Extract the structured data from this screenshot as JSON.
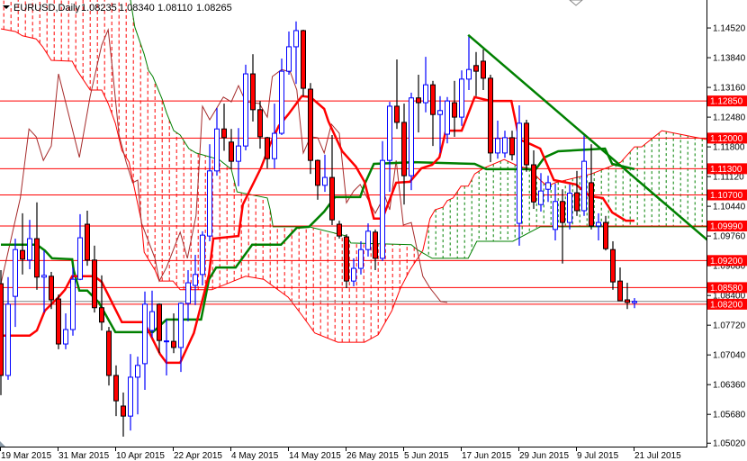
{
  "header": {
    "symbol": "EURUSD,Daily",
    "open": "1.08235",
    "high": "1.08340",
    "low": "1.08110",
    "close": "1.08265"
  },
  "colors": {
    "bull": "#0000ff",
    "bear": "#ff0000",
    "tenkan": "#ff0000",
    "kijun": "#008000",
    "chikou": "#a52a2a",
    "senkou_a": "#ff0000",
    "senkou_b": "#008000",
    "trendline": "#008000",
    "level": "#ff0000",
    "current": "#808080"
  },
  "chart_data": {
    "type": "candlestick",
    "title": "EURUSD,Daily",
    "ylim": [
      1.0492,
      1.1516
    ],
    "price_ticks": [
      "1.14520",
      "1.13840",
      "1.13160",
      "1.12480",
      "1.11800",
      "1.11120",
      "1.10440",
      "1.09760",
      "1.09080",
      "1.08400",
      "1.07720",
      "1.07040",
      "1.06360",
      "1.05680",
      "1.05020"
    ],
    "date_ticks": [
      {
        "label": "19 Mar 2015",
        "index": 0
      },
      {
        "label": "31 Mar 2015",
        "index": 8
      },
      {
        "label": "10 Apr 2015",
        "index": 16
      },
      {
        "label": "22 Apr 2015",
        "index": 24
      },
      {
        "label": "4 May 2015",
        "index": 32
      },
      {
        "label": "14 May 2015",
        "index": 40
      },
      {
        "label": "26 May 2015",
        "index": 48
      },
      {
        "label": "5 Jun 2015",
        "index": 56
      },
      {
        "label": "17 Jun 2015",
        "index": 64
      },
      {
        "label": "29 Jun 2015",
        "index": 72
      },
      {
        "label": "9 Jul 2015",
        "index": 80
      },
      {
        "label": "21 Jul 2015",
        "index": 88
      }
    ],
    "levels": [
      "1.12850",
      "1.12000",
      "1.11300",
      "1.10700",
      "1.09990",
      "1.09200",
      "1.08580",
      "1.08200"
    ],
    "current_price": 1.08265,
    "ohlc": [
      [
        1.0867,
        1.0898,
        1.0612,
        1.0657
      ],
      [
        1.0657,
        1.0882,
        1.0647,
        1.082
      ],
      [
        1.0838,
        1.097,
        1.0768,
        1.0945
      ],
      [
        1.0943,
        1.1028,
        1.0888,
        1.0923
      ],
      [
        1.0921,
        1.1013,
        1.09,
        1.097
      ],
      [
        1.097,
        1.1053,
        1.0853,
        1.0882
      ],
      [
        1.0882,
        1.0943,
        1.0801,
        1.0886
      ],
      [
        1.0884,
        1.0894,
        1.0809,
        1.083
      ],
      [
        1.0832,
        1.0842,
        1.0717,
        1.0729
      ],
      [
        1.0729,
        1.0799,
        1.0717,
        1.0762
      ],
      [
        1.0762,
        1.0904,
        1.0748,
        1.0877
      ],
      [
        1.0877,
        1.1026,
        1.0875,
        1.0972
      ],
      [
        1.1003,
        1.1034,
        1.0908,
        1.0921
      ],
      [
        1.0921,
        1.0954,
        1.0801,
        1.0812
      ],
      [
        1.0812,
        1.0886,
        1.076,
        1.0779
      ],
      [
        1.0758,
        1.0768,
        1.0634,
        1.0657
      ],
      [
        1.0657,
        1.068,
        1.0564,
        1.0599
      ],
      [
        1.0587,
        1.0618,
        1.0517,
        1.0564
      ],
      [
        1.0564,
        1.0706,
        1.0531,
        1.0653
      ],
      [
        1.0653,
        1.07,
        1.0568,
        1.068
      ],
      [
        1.0684,
        1.0849,
        1.0624,
        1.082
      ],
      [
        1.076,
        1.0851,
        1.0744,
        1.0803
      ],
      [
        1.082,
        1.0822,
        1.0708,
        1.0737
      ],
      [
        1.0735,
        1.0785,
        1.0657,
        1.0736
      ],
      [
        1.0735,
        1.0799,
        1.0708,
        1.0721
      ],
      [
        1.0721,
        1.0824,
        1.0665,
        1.0822
      ],
      [
        1.0822,
        1.0898,
        1.0781,
        1.0869
      ],
      [
        1.0863,
        1.0933,
        1.0818,
        1.0888
      ],
      [
        1.0888,
        1.0987,
        1.0863,
        1.0978
      ],
      [
        1.0976,
        1.1186,
        1.0964,
        1.1125
      ],
      [
        1.1125,
        1.1269,
        1.1114,
        1.1221
      ],
      [
        1.1221,
        1.1279,
        1.1171,
        1.1201
      ],
      [
        1.1191,
        1.1221,
        1.1129,
        1.1147
      ],
      [
        1.1147,
        1.1223,
        1.109,
        1.1182
      ],
      [
        1.1182,
        1.1368,
        1.1172,
        1.1347
      ],
      [
        1.1347,
        1.1392,
        1.1238,
        1.1265
      ],
      [
        1.1265,
        1.1285,
        1.1176,
        1.1203
      ],
      [
        1.1201,
        1.1203,
        1.1131,
        1.1153
      ],
      [
        1.1153,
        1.1279,
        1.1131,
        1.1211
      ],
      [
        1.1211,
        1.1382,
        1.1207,
        1.1353
      ],
      [
        1.1353,
        1.1444,
        1.1345,
        1.1409
      ],
      [
        1.1409,
        1.1467,
        1.1324,
        1.1446
      ],
      [
        1.1446,
        1.1448,
        1.1296,
        1.1314
      ],
      [
        1.1312,
        1.1326,
        1.1118,
        1.1149
      ],
      [
        1.1149,
        1.1151,
        1.1059,
        1.1092
      ],
      [
        1.1092,
        1.1162,
        1.1077,
        1.111
      ],
      [
        1.111,
        1.1207,
        1.1001,
        1.1013
      ],
      [
        1.1003,
        1.1011,
        1.097,
        1.0976
      ],
      [
        1.0974,
        1.098,
        1.0857,
        1.0873
      ],
      [
        1.0873,
        1.0925,
        1.0861,
        1.0902
      ],
      [
        1.0902,
        1.0964,
        1.0888,
        1.0945
      ],
      [
        1.0945,
        1.1005,
        1.0929,
        1.0987
      ],
      [
        1.0985,
        1.0991,
        1.0898,
        1.0925
      ],
      [
        1.0925,
        1.1193,
        1.0919,
        1.1149
      ],
      [
        1.1149,
        1.1283,
        1.1077,
        1.1273
      ],
      [
        1.1273,
        1.138,
        1.1221,
        1.1236
      ],
      [
        1.1236,
        1.1279,
        1.1048,
        1.1114
      ],
      [
        1.1114,
        1.1304,
        1.1081,
        1.1292
      ],
      [
        1.1292,
        1.1345,
        1.1213,
        1.1281
      ],
      [
        1.1281,
        1.1386,
        1.1259,
        1.1322
      ],
      [
        1.1322,
        1.1331,
        1.1182,
        1.1254
      ],
      [
        1.1254,
        1.1296,
        1.1166,
        1.1263
      ],
      [
        1.1209,
        1.1294,
        1.1188,
        1.1285
      ],
      [
        1.1281,
        1.1331,
        1.1203,
        1.1248
      ],
      [
        1.1248,
        1.1355,
        1.1228,
        1.1335
      ],
      [
        1.1335,
        1.1436,
        1.131,
        1.1357
      ],
      [
        1.1366,
        1.1397,
        1.1296,
        1.1353
      ],
      [
        1.1376,
        1.1403,
        1.131,
        1.1337
      ],
      [
        1.1337,
        1.1345,
        1.1145,
        1.1166
      ],
      [
        1.1166,
        1.124,
        1.1153,
        1.1199
      ],
      [
        1.1166,
        1.1217,
        1.1155,
        1.1201
      ],
      [
        1.1201,
        1.1217,
        1.1149,
        1.1162
      ],
      [
        1.1005,
        1.1275,
        1.0954,
        1.1234
      ],
      [
        1.1234,
        1.1242,
        1.1123,
        1.1139
      ],
      [
        1.1139,
        1.1172,
        1.1038,
        1.1054
      ],
      [
        1.1048,
        1.112,
        1.1032,
        1.1079
      ],
      [
        1.1083,
        1.1114,
        1.1054,
        1.1098
      ],
      [
        1.0991,
        1.1096,
        1.0966,
        1.1055
      ],
      [
        1.1055,
        1.1083,
        1.0913,
        1.1007
      ],
      [
        1.1007,
        1.1094,
        1.0991,
        1.1074
      ],
      [
        1.1075,
        1.1125,
        1.1022,
        1.1034
      ],
      [
        1.1034,
        1.1207,
        1.1022,
        1.1147
      ],
      [
        1.1098,
        1.1186,
        1.0991,
        1.0999
      ],
      [
        1.0999,
        1.1028,
        1.0966,
        1.1007
      ],
      [
        1.1007,
        1.1022,
        1.0943,
        1.0947
      ],
      [
        1.0945,
        1.0964,
        1.0853,
        1.0871
      ],
      [
        1.0873,
        1.0904,
        1.0828,
        1.0828
      ],
      [
        1.083,
        1.0869,
        1.0809,
        1.0824
      ],
      [
        1.08235,
        1.0834,
        1.0811,
        1.08265
      ]
    ],
    "tenkan": [
      [
        0,
        1.0748
      ],
      [
        4,
        1.0748
      ],
      [
        5,
        1.076
      ],
      [
        6.1,
        1.0805
      ],
      [
        8,
        1.0836
      ],
      [
        8.9,
        1.0853
      ],
      [
        9.9,
        1.0884
      ],
      [
        13,
        1.0884
      ],
      [
        14,
        1.0871
      ],
      [
        16.8,
        1.0779
      ],
      [
        19.9,
        1.0779
      ],
      [
        22.1,
        1.0706
      ],
      [
        23,
        1.0686
      ],
      [
        24.9,
        1.0686
      ],
      [
        26.8,
        1.0754
      ],
      [
        28.9,
        1.0888
      ],
      [
        29.5,
        1.097
      ],
      [
        33,
        1.0976
      ],
      [
        33.6,
        1.1048
      ],
      [
        36.1,
        1.1131
      ],
      [
        37.4,
        1.1186
      ],
      [
        38.6,
        1.1228
      ],
      [
        39.9,
        1.1254
      ],
      [
        41.8,
        1.1296
      ],
      [
        43,
        1.1294
      ],
      [
        44.9,
        1.1267
      ],
      [
        45.5,
        1.1238
      ],
      [
        47.4,
        1.117
      ],
      [
        49.3,
        1.1135
      ],
      [
        50.5,
        1.11
      ],
      [
        51.8,
        1.1016
      ],
      [
        53,
        1.1016
      ],
      [
        54.9,
        1.1098
      ],
      [
        56.8,
        1.11
      ],
      [
        58.4,
        1.1131
      ],
      [
        59.9,
        1.1139
      ],
      [
        60.9,
        1.1156
      ],
      [
        61.8,
        1.1217
      ],
      [
        64,
        1.1217
      ],
      [
        65.8,
        1.1294
      ],
      [
        68,
        1.1285
      ],
      [
        70.9,
        1.1285
      ],
      [
        72,
        1.1197
      ],
      [
        73.6,
        1.1186
      ],
      [
        74.9,
        1.1176
      ],
      [
        76.8,
        1.1104
      ],
      [
        79.9,
        1.1094
      ],
      [
        81.8,
        1.1067
      ],
      [
        83.6,
        1.1063
      ],
      [
        84.9,
        1.103
      ],
      [
        86.8,
        1.1011
      ],
      [
        88,
        1.1011
      ]
    ],
    "kijun": [
      [
        0,
        1.0956
      ],
      [
        5,
        1.0956
      ],
      [
        6.1,
        1.0943
      ],
      [
        7.1,
        1.0925
      ],
      [
        9.9,
        1.0923
      ],
      [
        10.1,
        1.0898
      ],
      [
        10.9,
        1.0851
      ],
      [
        12,
        1.0851
      ],
      [
        13.6,
        1.0824
      ],
      [
        15.9,
        1.0756
      ],
      [
        21.1,
        1.0756
      ],
      [
        23,
        1.0785
      ],
      [
        27.8,
        1.0785
      ],
      [
        28.9,
        1.0877
      ],
      [
        29.9,
        1.0904
      ],
      [
        32.6,
        1.0904
      ],
      [
        34.9,
        1.0956
      ],
      [
        38.9,
        1.0956
      ],
      [
        41.1,
        1.0995
      ],
      [
        42.8,
        1.0997
      ],
      [
        44.9,
        1.1032
      ],
      [
        46.4,
        1.1065
      ],
      [
        49.9,
        1.1065
      ],
      [
        50.5,
        1.1094
      ],
      [
        51.8,
        1.1141
      ],
      [
        57.4,
        1.1145
      ],
      [
        65.8,
        1.1141
      ],
      [
        67.4,
        1.1129
      ],
      [
        74.3,
        1.1129
      ],
      [
        75.5,
        1.1156
      ],
      [
        77.4,
        1.117
      ],
      [
        83.9,
        1.1176
      ],
      [
        84.9,
        1.1141
      ],
      [
        88,
        1.1129
      ]
    ],
    "chikou": [
      [
        0,
        1.0867
      ],
      [
        2.7,
        1.1063
      ],
      [
        3.9,
        1.1221
      ],
      [
        4.9,
        1.1203
      ],
      [
        5.9,
        1.1149
      ],
      [
        7,
        1.1182
      ],
      [
        8,
        1.1347
      ],
      [
        10.9,
        1.1156
      ],
      [
        12.4,
        1.1296
      ],
      [
        14,
        1.1413
      ],
      [
        14.9,
        1.1448
      ],
      [
        15.5,
        1.1357
      ],
      [
        16.4,
        1.1207
      ],
      [
        17.4,
        1.1145
      ],
      [
        18.3,
        1.1098
      ],
      [
        19,
        1.1104
      ],
      [
        19.5,
        1.1007
      ],
      [
        21.4,
        1.0925
      ],
      [
        22,
        1.0873
      ],
      [
        23,
        1.0904
      ],
      [
        24.9,
        1.0985
      ],
      [
        25.9,
        1.0925
      ],
      [
        27.1,
        1.1022
      ],
      [
        27.6,
        1.1156
      ],
      [
        28,
        1.1273
      ],
      [
        29,
        1.1242
      ],
      [
        30.9,
        1.1294
      ],
      [
        32,
        1.1283
      ],
      [
        33,
        1.132
      ],
      [
        34,
        1.1283
      ],
      [
        35.9,
        1.1279
      ],
      [
        37,
        1.1248
      ],
      [
        37.7,
        1.1341
      ],
      [
        39,
        1.1357
      ],
      [
        40.2,
        1.1351
      ],
      [
        41.1,
        1.131
      ],
      [
        42,
        1.1166
      ],
      [
        43,
        1.1203
      ],
      [
        44,
        1.1201
      ],
      [
        44.9,
        1.1166
      ],
      [
        45.9,
        1.1232
      ],
      [
        47,
        1.1211
      ],
      [
        48,
        1.1052
      ],
      [
        49,
        1.1079
      ],
      [
        49.9,
        1.1094
      ],
      [
        52,
        1.1028
      ],
      [
        53.3,
        1.1069
      ],
      [
        54,
        1.1036
      ],
      [
        54.9,
        1.1149
      ],
      [
        55.9,
        1.1001
      ],
      [
        57,
        1.1007
      ],
      [
        58.6,
        1.0884
      ],
      [
        59.6,
        1.0857
      ],
      [
        61.1,
        1.0826
      ],
      [
        62,
        1.0824
      ]
    ],
    "senkou_a": [
      [
        0,
        1.145
      ],
      [
        2,
        1.1444
      ],
      [
        3,
        1.1434
      ],
      [
        4.9,
        1.1427
      ],
      [
        5.8,
        1.1409
      ],
      [
        7,
        1.1378
      ],
      [
        9.9,
        1.1376
      ],
      [
        10.5,
        1.1357
      ],
      [
        12.4,
        1.131
      ],
      [
        14,
        1.131
      ],
      [
        14.9,
        1.1279
      ],
      [
        15.9,
        1.1234
      ],
      [
        16.8,
        1.1172
      ],
      [
        17.8,
        1.1145
      ],
      [
        18.3,
        1.1104
      ],
      [
        19.5,
        1.1011
      ],
      [
        19.9,
        1.0939
      ],
      [
        21.4,
        1.0898
      ],
      [
        22,
        1.0873
      ],
      [
        23.9,
        1.0873
      ],
      [
        24.9,
        1.0853
      ],
      [
        29.3,
        1.0853
      ],
      [
        34,
        1.0884
      ],
      [
        36.5,
        1.0877
      ],
      [
        39.9,
        1.0836
      ],
      [
        41.8,
        1.0795
      ],
      [
        43.6,
        1.0754
      ],
      [
        46.8,
        1.0733
      ],
      [
        50.5,
        1.0733
      ],
      [
        52.4,
        1.075
      ],
      [
        54.3,
        1.0805
      ],
      [
        55.5,
        1.0857
      ],
      [
        56.8,
        1.0898
      ],
      [
        58.6,
        1.0943
      ],
      [
        59.6,
        1.1016
      ],
      [
        60.3,
        1.1036
      ],
      [
        61.4,
        1.1042
      ],
      [
        62,
        1.1057
      ],
      [
        62.8,
        1.1063
      ],
      [
        63.9,
        1.109
      ],
      [
        64.9,
        1.109
      ],
      [
        65.8,
        1.1118
      ],
      [
        67,
        1.1131
      ],
      [
        69.9,
        1.1151
      ],
      [
        72,
        1.1135
      ],
      [
        73.3,
        1.1131
      ],
      [
        74.9,
        1.1104
      ],
      [
        75.9,
        1.109
      ],
      [
        77,
        1.1098
      ],
      [
        82,
        1.1118
      ],
      [
        84,
        1.1131
      ],
      [
        86.1,
        1.1145
      ],
      [
        88,
        1.118
      ],
      [
        89,
        1.118
      ],
      [
        91.8,
        1.1217
      ],
      [
        94.9,
        1.1207
      ],
      [
        98,
        1.1197
      ]
    ],
    "senkou_b": [
      [
        0,
        1.1537
      ],
      [
        17.4,
        1.1526
      ],
      [
        18,
        1.1516
      ],
      [
        18.6,
        1.1454
      ],
      [
        19.9,
        1.1392
      ],
      [
        20.5,
        1.1355
      ],
      [
        21.1,
        1.1341
      ],
      [
        22.4,
        1.1289
      ],
      [
        23,
        1.1258
      ],
      [
        24,
        1.1217
      ],
      [
        24.9,
        1.1207
      ],
      [
        26.1,
        1.1176
      ],
      [
        27.1,
        1.1166
      ],
      [
        30.3,
        1.1151
      ],
      [
        32,
        1.1129
      ],
      [
        32.8,
        1.1077
      ],
      [
        37,
        1.1063
      ],
      [
        37.4,
        1.1036
      ],
      [
        37.8,
        1.0997
      ],
      [
        42.8,
        1.0997
      ],
      [
        48,
        1.0976
      ],
      [
        48.6,
        1.096
      ],
      [
        57,
        1.0956
      ],
      [
        57.8,
        1.0945
      ],
      [
        59.9,
        1.0925
      ],
      [
        64.9,
        1.0925
      ],
      [
        66.1,
        1.0964
      ],
      [
        71.1,
        1.0964
      ],
      [
        74.9,
        1.0997
      ],
      [
        98,
        1.0997
      ]
    ],
    "trendline": [
      [
        64.9,
        1.1436
      ],
      [
        98.6,
        1.096
      ]
    ]
  }
}
